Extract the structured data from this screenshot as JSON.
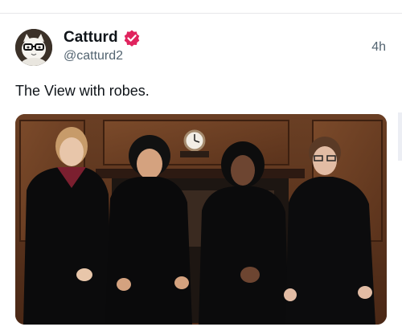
{
  "post": {
    "author_name": "Catturd",
    "author_handle": "@catturd2",
    "timestamp": "4h",
    "text": "The View with robes.",
    "verified": true
  },
  "colors": {
    "verified_badge": "#e0245e",
    "text_primary": "#0f1419",
    "text_secondary": "#536471"
  },
  "icons": {
    "verified": "verified-badge-icon",
    "avatar": "cat-with-glasses-avatar"
  }
}
